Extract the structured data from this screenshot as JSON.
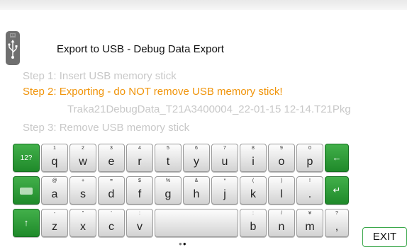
{
  "header": {
    "title": "Export to USB - Debug Data Export",
    "usb_icon": "usb-drive-icon"
  },
  "steps": [
    {
      "text": "Step 1: Insert USB memory stick",
      "state": "inactive"
    },
    {
      "text": "Step 2: Exporting - do NOT remove USB memory stick!",
      "state": "active"
    },
    {
      "text": "Step 3: Remove USB memory stick",
      "state": "inactive"
    }
  ],
  "file_name": "Traka21DebugData_T21A3400004_22-01-15 12-14.T21Pkg",
  "keyboard": {
    "row1": [
      {
        "main": "q",
        "alt": "1"
      },
      {
        "main": "w",
        "alt": "2"
      },
      {
        "main": "e",
        "alt": "3"
      },
      {
        "main": "r",
        "alt": "4"
      },
      {
        "main": "t",
        "alt": "5"
      },
      {
        "main": "y",
        "alt": "6"
      },
      {
        "main": "u",
        "alt": "7"
      },
      {
        "main": "i",
        "alt": "8"
      },
      {
        "main": "o",
        "alt": "9"
      },
      {
        "main": "p",
        "alt": "0"
      }
    ],
    "row2": [
      {
        "main": "a",
        "alt": "@"
      },
      {
        "main": "s",
        "alt": "+"
      },
      {
        "main": "d",
        "alt": "="
      },
      {
        "main": "f",
        "alt": "$"
      },
      {
        "main": "g",
        "alt": "%"
      },
      {
        "main": "h",
        "alt": "&"
      },
      {
        "main": "j",
        "alt": "*"
      },
      {
        "main": "k",
        "alt": "("
      },
      {
        "main": "l",
        "alt": ")"
      },
      {
        "main": ".",
        "alt": "!"
      }
    ],
    "row3": [
      {
        "main": "z",
        "alt": "-"
      },
      {
        "main": "x",
        "alt": "\""
      },
      {
        "main": "c",
        "alt": "'"
      },
      {
        "main": "v",
        "alt": ":"
      },
      {
        "main": "",
        "alt": ""
      },
      {
        "main": "b",
        "alt": ":"
      },
      {
        "main": "n",
        "alt": "/"
      },
      {
        "main": "m",
        "alt": "¥"
      },
      {
        "main": ",",
        "alt": "?"
      }
    ],
    "symbols_key": "12?",
    "backspace_icon": "backspace-arrow-icon",
    "enter_icon": "enter-arrow-icon",
    "shift_icon": "shift-arrow-icon",
    "keyboard_icon": "keyboard-icon"
  },
  "page_dots": {
    "count": 2,
    "active": 1
  },
  "exit_label": "EXIT",
  "colors": {
    "accent_green": "#1f8a2a",
    "active_step": "#f0940a",
    "inactive": "#c8c8c8"
  }
}
